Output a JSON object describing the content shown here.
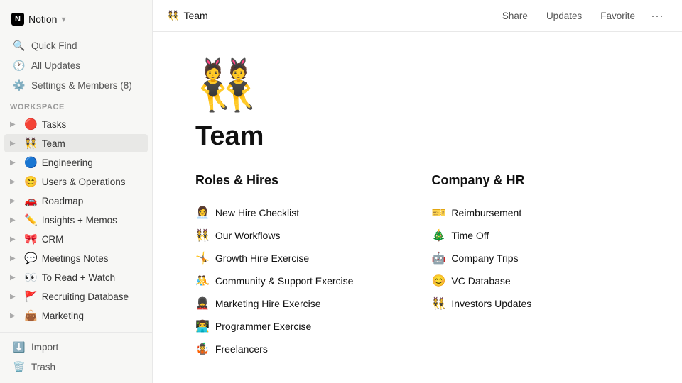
{
  "brand": {
    "name": "Notion",
    "icon_letter": "N",
    "workspace_caret": "▾"
  },
  "sidebar": {
    "nav": [
      {
        "id": "quick-find",
        "icon": "🔍",
        "label": "Quick Find"
      },
      {
        "id": "all-updates",
        "icon": "🕐",
        "label": "All Updates"
      },
      {
        "id": "settings",
        "icon": "⚙️",
        "label": "Settings & Members (8)"
      }
    ],
    "workspace_label": "WORKSPACE",
    "workspace_items": [
      {
        "id": "tasks",
        "emoji": "🔴",
        "label": "Tasks",
        "active": false
      },
      {
        "id": "team",
        "emoji": "👯",
        "label": "Team",
        "active": true
      },
      {
        "id": "engineering",
        "emoji": "🔵",
        "label": "Engineering",
        "active": false
      },
      {
        "id": "users-ops",
        "emoji": "😊",
        "label": "Users & Operations",
        "active": false
      },
      {
        "id": "roadmap",
        "emoji": "🚗",
        "label": "Roadmap",
        "active": false
      },
      {
        "id": "insights",
        "emoji": "✏️",
        "label": "Insights + Memos",
        "active": false
      },
      {
        "id": "crm",
        "emoji": "🎀",
        "label": "CRM",
        "active": false
      },
      {
        "id": "meetings",
        "emoji": "💬",
        "label": "Meetings Notes",
        "active": false
      },
      {
        "id": "to-read",
        "emoji": "👀",
        "label": "To Read + Watch",
        "active": false
      },
      {
        "id": "recruiting",
        "emoji": "🚩",
        "label": "Recruiting Database",
        "active": false
      },
      {
        "id": "marketing",
        "emoji": "👜",
        "label": "Marketing",
        "active": false
      }
    ],
    "bottom_items": [
      {
        "id": "import",
        "icon": "⬇️",
        "label": "Import"
      },
      {
        "id": "trash",
        "icon": "🗑️",
        "label": "Trash"
      }
    ]
  },
  "topbar": {
    "emoji": "👯",
    "title": "Team",
    "actions": [
      "Share",
      "Updates",
      "Favorite"
    ],
    "dots": "···"
  },
  "page": {
    "emoji": "👯",
    "title": "Team",
    "columns": [
      {
        "id": "roles-hires",
        "heading": "Roles & Hires",
        "items": [
          {
            "emoji": "👩‍💼",
            "label": "New Hire Checklist"
          },
          {
            "emoji": "👯",
            "label": "Our Workflows"
          },
          {
            "emoji": "🤸",
            "label": "Growth Hire Exercise"
          },
          {
            "emoji": "🤼",
            "label": "Community & Support Exercise"
          },
          {
            "emoji": "💂",
            "label": "Marketing Hire Exercise"
          },
          {
            "emoji": "👨‍💻",
            "label": "Programmer Exercise"
          },
          {
            "emoji": "🤹",
            "label": "Freelancers"
          }
        ]
      },
      {
        "id": "company-hr",
        "heading": "Company & HR",
        "items": [
          {
            "emoji": "🎫",
            "label": "Reimbursement"
          },
          {
            "emoji": "🎄",
            "label": "Time Off"
          },
          {
            "emoji": "🤖",
            "label": "Company Trips"
          },
          {
            "emoji": "😊",
            "label": "VC Database"
          },
          {
            "emoji": "👯",
            "label": "Investors Updates"
          }
        ]
      }
    ]
  }
}
